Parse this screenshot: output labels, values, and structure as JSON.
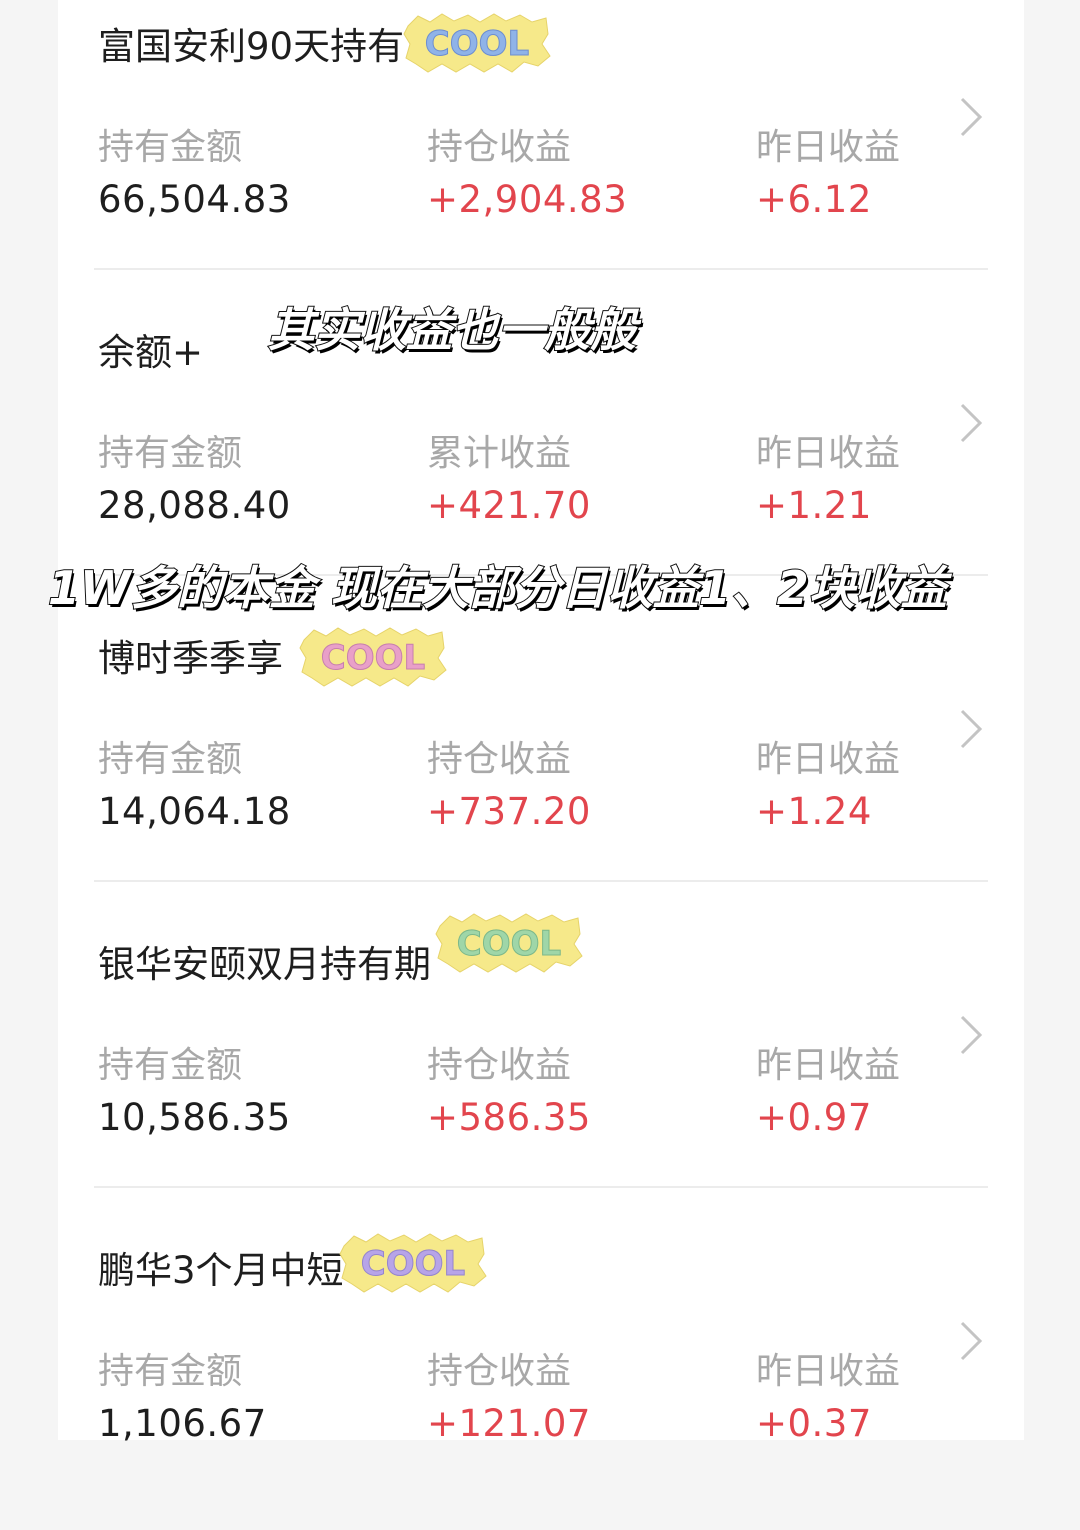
{
  "funds": [
    {
      "name": "富国安利90天持有",
      "labels": [
        "持有金额",
        "持仓收益",
        "昨日收益"
      ],
      "values": [
        "66,504.83",
        "+2,904.83",
        "+6.12"
      ]
    },
    {
      "name": "余额+",
      "labels": [
        "持有金额",
        "累计收益",
        "昨日收益"
      ],
      "values": [
        "28,088.40",
        "+421.70",
        "+1.21"
      ]
    },
    {
      "name": "博时季季享",
      "labels": [
        "持有金额",
        "持仓收益",
        "昨日收益"
      ],
      "values": [
        "14,064.18",
        "+737.20",
        "+1.24"
      ]
    },
    {
      "name": "银华安颐双月持有期",
      "labels": [
        "持有金额",
        "持仓收益",
        "昨日收益"
      ],
      "values": [
        "10,586.35",
        "+586.35",
        "+0.97"
      ]
    },
    {
      "name": "鹏华3个月中短",
      "labels": [
        "持有金额",
        "持仓收益",
        "昨日收益"
      ],
      "values": [
        "1,106.67",
        "+121.07",
        "+0.37"
      ]
    }
  ],
  "stickers": {
    "text": "COOL"
  },
  "captions": {
    "top": "其实收益也一般般",
    "middle": "1W多的本金 现在大部分日收益1、2块收益"
  },
  "colors": {
    "positive": "#e2454d",
    "label": "#a8a8a8",
    "text": "#1e1e1e",
    "sticker_bg": "#f6e98a"
  }
}
